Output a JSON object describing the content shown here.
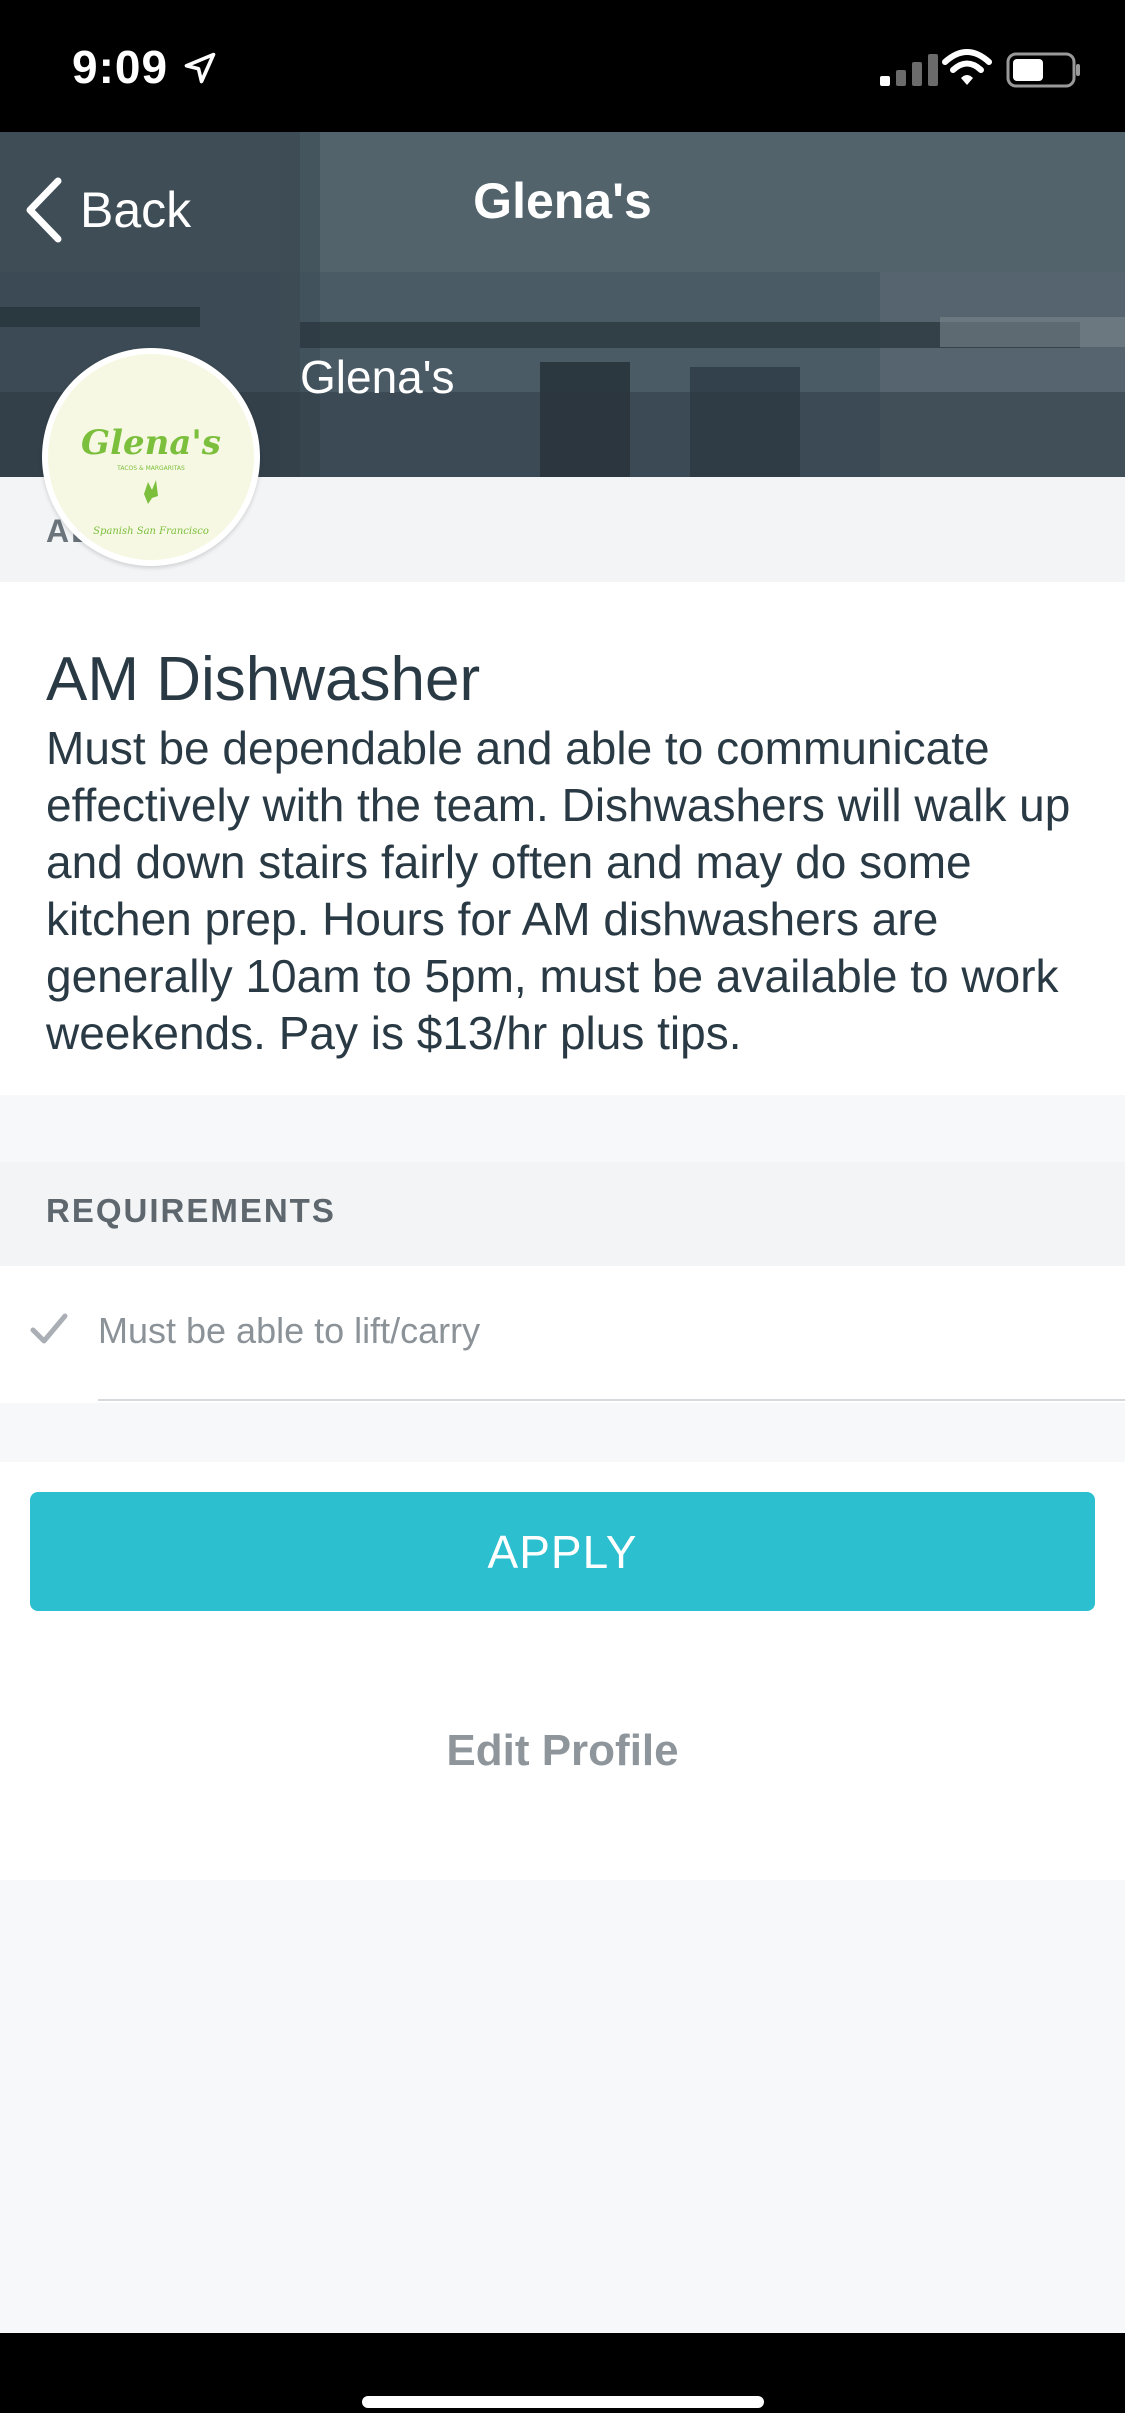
{
  "status_bar": {
    "time": "9:09"
  },
  "nav": {
    "back_label": "Back",
    "title": "Glena's"
  },
  "employer": {
    "name": "Glena's",
    "logo_text": "Glena's",
    "logo_tagline": "TACOS & MARGARITAS",
    "logo_bottom_text": "Spanish San Francisco"
  },
  "about": {
    "label": "AB"
  },
  "job": {
    "title": "AM Dishwasher",
    "description": "Must be dependable and able to communicate effectively with the team. Dishwashers will walk up and down stairs fairly often and may do some kitchen prep. Hours for AM dishwashers are generally 10am to 5pm, must be available to work weekends. Pay is $13/hr plus tips."
  },
  "requirements": {
    "label": "REQUIREMENTS",
    "items": [
      {
        "text": "Must be able to lift/carry",
        "icon": "check-icon"
      }
    ]
  },
  "actions": {
    "apply_label": "APPLY",
    "edit_profile_label": "Edit Profile"
  },
  "colors": {
    "accent": "#2bbfcf",
    "text_dark": "#2a3a45",
    "text_muted": "#8e969c",
    "logo_green": "#7cbf3c"
  }
}
